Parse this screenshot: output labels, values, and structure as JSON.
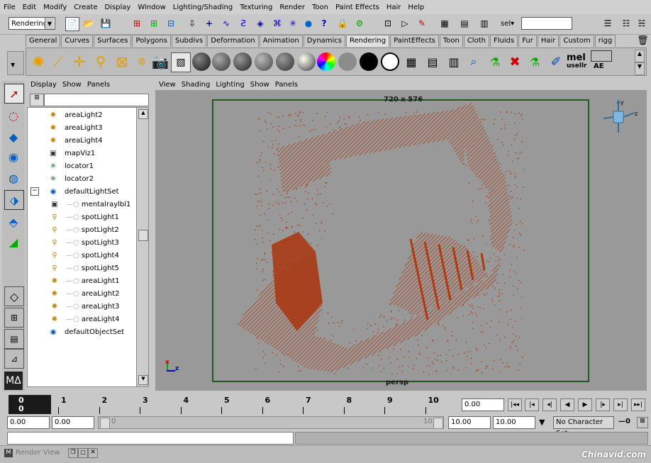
{
  "menu": [
    "File",
    "Edit",
    "Modify",
    "Create",
    "Display",
    "Window",
    "Lighting/Shading",
    "Texturing",
    "Render",
    "Toon",
    "Paint Effects",
    "Hair",
    "Help"
  ],
  "status": {
    "mode": "Rendering",
    "sel_label": "sel▾",
    "sel_value": ""
  },
  "shelf_tabs": [
    "General",
    "Curves",
    "Surfaces",
    "Polygons",
    "Subdivs",
    "Deformation",
    "Animation",
    "Dynamics",
    "Rendering",
    "PaintEffects",
    "Toon",
    "Cloth",
    "Fluids",
    "Fur",
    "Hair",
    "Custom",
    "rigg"
  ],
  "shelf_text": {
    "mel_label": "mel",
    "usell_label": "usellr",
    "ae_label": "AE"
  },
  "outliner": {
    "menu": [
      "Display",
      "Show",
      "Panels"
    ],
    "items": [
      {
        "label": "areaLight2",
        "icon": "area-light-icon",
        "child": false
      },
      {
        "label": "areaLight3",
        "icon": "area-light-icon",
        "child": false
      },
      {
        "label": "areaLight4",
        "icon": "area-light-icon",
        "child": false
      },
      {
        "label": "mapViz1",
        "icon": "cube-icon",
        "child": false
      },
      {
        "label": "locator1",
        "icon": "locator-icon",
        "child": false
      },
      {
        "label": "locator2",
        "icon": "locator-icon",
        "child": false
      },
      {
        "label": "defaultLightSet",
        "icon": "set-icon",
        "child": false
      },
      {
        "label": "mentalraylbl1",
        "icon": "cube-icon",
        "child": true
      },
      {
        "label": "spotLight1",
        "icon": "spot-light-icon",
        "child": true
      },
      {
        "label": "spotLight2",
        "icon": "spot-light-icon",
        "child": true
      },
      {
        "label": "spotLight3",
        "icon": "spot-light-icon",
        "child": true
      },
      {
        "label": "spotLight4",
        "icon": "spot-light-icon",
        "child": true
      },
      {
        "label": "spotLight5",
        "icon": "spot-light-icon",
        "child": true
      },
      {
        "label": "areaLight1",
        "icon": "area-light-icon",
        "child": true
      },
      {
        "label": "areaLight2",
        "icon": "area-light-icon",
        "child": true
      },
      {
        "label": "areaLight3",
        "icon": "area-light-icon",
        "child": true
      },
      {
        "label": "areaLight4",
        "icon": "area-light-icon",
        "child": true
      },
      {
        "label": "defaultObjectSet",
        "icon": "set-icon",
        "child": false
      }
    ]
  },
  "viewport": {
    "menu": [
      "View",
      "Shading",
      "Lighting",
      "Show",
      "Panels"
    ],
    "resolution": "720 x 576",
    "camera": "persp",
    "axis_x": "x",
    "axis_z": "z",
    "point_color": "#b03a10",
    "gate_color": "#1f5a1f",
    "bg_color": "#999999"
  },
  "timeline": {
    "labels": [
      "1",
      "2",
      "3",
      "4",
      "5",
      "6",
      "7",
      "8",
      "9",
      "10"
    ],
    "current_frame": "0",
    "current_field": "0.00",
    "start": "0.00",
    "anim_start": "0.00",
    "range_start_marker": "0",
    "range_end_marker": "10",
    "range_end": "10.00",
    "anim_end": "10.00",
    "character_set": "No Character Set",
    "key_label": "—0"
  },
  "taskbar": {
    "title": "Render View"
  },
  "watermark": "Chinavid.com"
}
